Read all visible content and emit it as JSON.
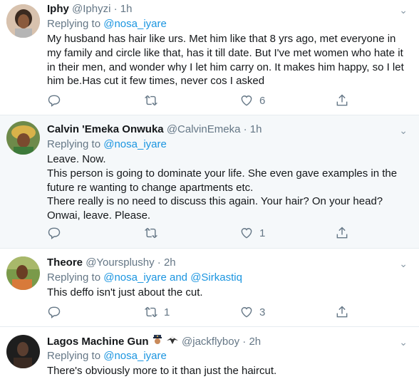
{
  "replying_prefix": "Replying to",
  "tweets": [
    {
      "name": "Iphy",
      "handle": "@Iphyzi",
      "time": "1h",
      "reply_to": "@nosa_iyare",
      "reply_to_extra_and": "",
      "reply_to_extra": "",
      "lines": [
        "My husband has hair like urs. Met him like that 8 yrs ago, met everyone in",
        "my family and circle like that, has it till date. But I've met women who hate it",
        "in their men, and wonder why I let him carry on. It makes him happy, so I let",
        "him be.Has cut it few times, never cos I asked"
      ],
      "retweets": "",
      "likes": "6"
    },
    {
      "name": "Calvin 'Emeka Onwuka",
      "handle": "@CalvinEmeka",
      "time": "1h",
      "reply_to": "@nosa_iyare",
      "lines": [
        "Leave. Now.",
        "This person is going to dominate your life. She even gave examples in the",
        "future re wanting to change apartments etc.",
        "There really is no need to discuss this again. Your hair? On your head?",
        "Onwai, leave. Please."
      ],
      "retweets": "",
      "likes": "1"
    },
    {
      "name": "Theore",
      "handle": "@Yoursplushy",
      "time": "2h",
      "reply_to": "@nosa_iyare",
      "reply_and": "and",
      "reply_to_2": "@Sirkastiq",
      "lines": [
        "This deffo isn't just about the cut."
      ],
      "retweets": "1",
      "likes": "3"
    },
    {
      "name": "Lagos Machine Gun",
      "handle": "@jackflyboy",
      "time": "2h",
      "reply_to": "@nosa_iyare",
      "lines": [
        "There's obviously more to it than just the haircut."
      ]
    }
  ],
  "icons": {
    "reply": "reply-icon",
    "retweet": "retweet-icon",
    "like": "heart-icon",
    "share": "share-icon",
    "more": "chevron-down-icon",
    "badges": [
      "police-officer-emoji",
      "eagle-emoji"
    ]
  },
  "colors": {
    "link": "#1b95e0",
    "secondary": "#657786",
    "highlight_bg": "#f5f8fa",
    "divider": "#e6ecf0"
  }
}
